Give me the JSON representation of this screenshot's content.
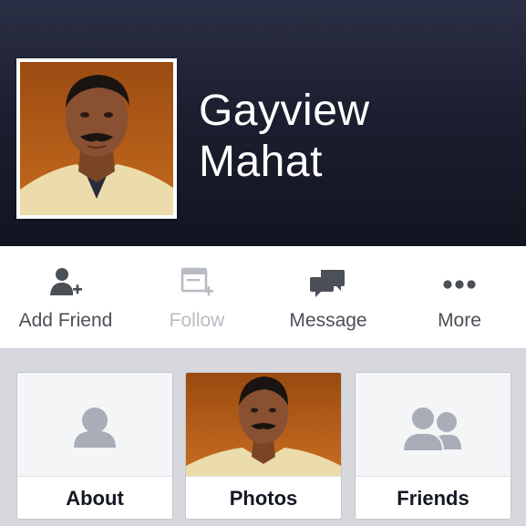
{
  "profile": {
    "name_line1": "Gayview",
    "name_line2": "Mahat"
  },
  "actions": [
    {
      "label": "Add Friend",
      "icon": "add-friend-icon",
      "enabled": true
    },
    {
      "label": "Follow",
      "icon": "follow-icon",
      "enabled": false
    },
    {
      "label": "Message",
      "icon": "message-icon",
      "enabled": true
    },
    {
      "label": "More",
      "icon": "more-icon",
      "enabled": true
    }
  ],
  "tiles": [
    {
      "label": "About",
      "icon": "person-silhouette-icon"
    },
    {
      "label": "Photos",
      "icon": "profile-photo-thumbnail"
    },
    {
      "label": "Friends",
      "icon": "friends-silhouette-icon"
    }
  ],
  "colors": {
    "cover_dark": "#1c1f30",
    "icon_gray": "#4b4f56",
    "disabled_gray": "#b7bbc2",
    "tile_bg": "#d6d8de",
    "silhouette": "#a9adb8"
  }
}
